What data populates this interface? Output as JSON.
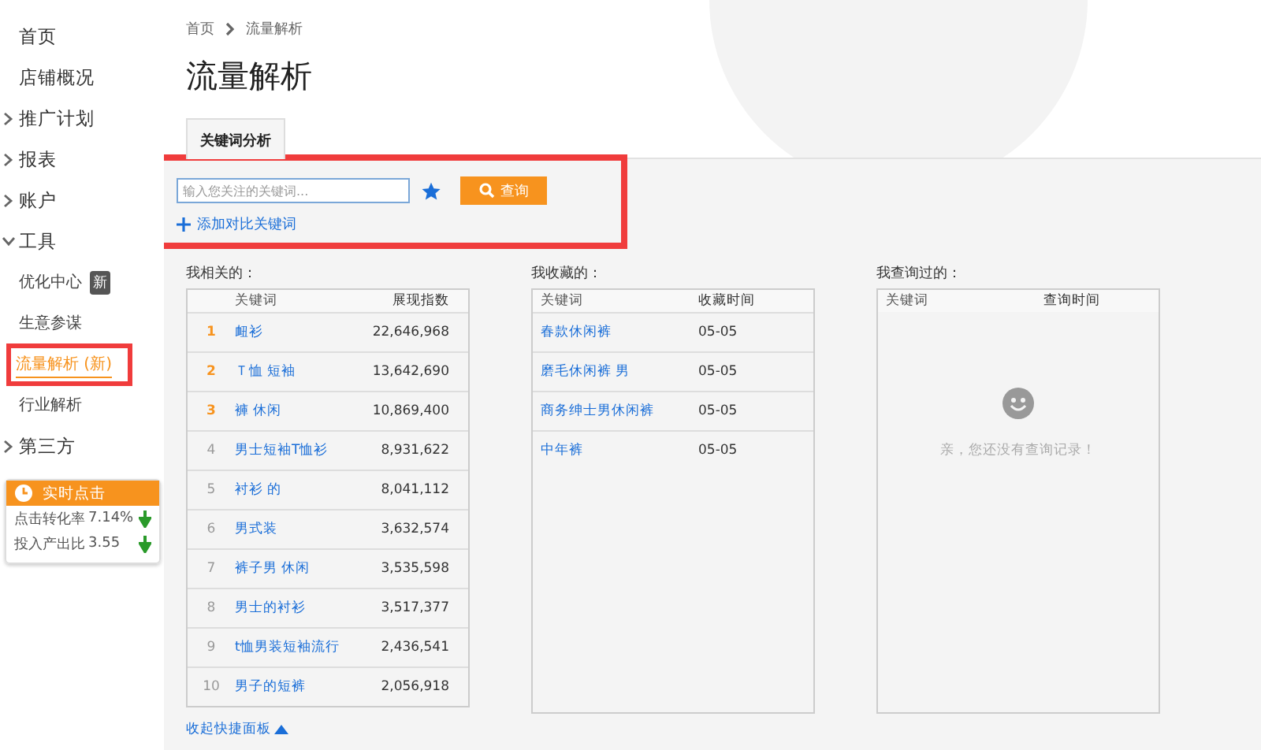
{
  "sidebar": {
    "items": [
      {
        "label": "首页",
        "kind": "link"
      },
      {
        "label": "店铺概况",
        "kind": "link"
      },
      {
        "label": "推广计划",
        "kind": "group",
        "expanded": false
      },
      {
        "label": "报表",
        "kind": "group",
        "expanded": false
      },
      {
        "label": "账户",
        "kind": "group",
        "expanded": false
      },
      {
        "label": "工具",
        "kind": "group",
        "expanded": true,
        "children": [
          {
            "label": "优化中心",
            "badge": "新",
            "selected": false,
            "highlighted": false
          },
          {
            "label": "生意参谋",
            "selected": false,
            "highlighted": false
          },
          {
            "label": "流量解析 (新)",
            "selected": true,
            "highlighted": true
          },
          {
            "label": "行业解析",
            "selected": false,
            "highlighted": false
          }
        ]
      },
      {
        "label": "第三方",
        "kind": "group",
        "expanded": false
      }
    ],
    "widget": {
      "title": "实时点击",
      "rows": [
        {
          "label": "点击转化率",
          "value": "7.14%"
        },
        {
          "label": "投入产出比",
          "value": "3.55"
        }
      ]
    }
  },
  "breadcrumb": [
    "首页",
    "流量解析"
  ],
  "page_title": "流量解析",
  "tabs": [
    {
      "label": "关键词分析",
      "selected": true
    }
  ],
  "search": {
    "placeholder": "输入您关注的关键词...",
    "button": "查询",
    "add_link": "添加对比关键词",
    "highlighted": true
  },
  "related": {
    "title": "我相关的：",
    "columns": [
      "关键词",
      "展现指数"
    ],
    "rows": [
      {
        "rank": "1",
        "keyword": "衄衫",
        "value": "22,646,968",
        "top": true
      },
      {
        "rank": "2",
        "keyword": "Ｔ恤 短袖",
        "value": "13,642,690",
        "top": true
      },
      {
        "rank": "3",
        "keyword": "褲 休闲",
        "value": "10,869,400",
        "top": true
      },
      {
        "rank": "4",
        "keyword": "男士短袖T恤衫",
        "value": "8,931,622",
        "top": false
      },
      {
        "rank": "5",
        "keyword": "衬衫 的",
        "value": "8,041,112",
        "top": false
      },
      {
        "rank": "6",
        "keyword": "男式装",
        "value": "3,632,574",
        "top": false
      },
      {
        "rank": "7",
        "keyword": "裤子男 休闲",
        "value": "3,535,598",
        "top": false
      },
      {
        "rank": "8",
        "keyword": "男士的衬衫",
        "value": "3,517,377",
        "top": false
      },
      {
        "rank": "9",
        "keyword": "t恤男装短袖流行",
        "value": "2,436,541",
        "top": false
      },
      {
        "rank": "10",
        "keyword": "男子的短裤",
        "value": "2,056,918",
        "top": false
      }
    ]
  },
  "favorites": {
    "title": "我收藏的：",
    "columns": [
      "关键词",
      "收藏时间"
    ],
    "rows": [
      {
        "keyword": "春款休闲裤",
        "time": "05-05"
      },
      {
        "keyword": "磨毛休闲裤 男",
        "time": "05-05"
      },
      {
        "keyword": "商务绅士男休闲裤",
        "time": "05-05"
      },
      {
        "keyword": "中年裤",
        "time": "05-05"
      }
    ]
  },
  "history": {
    "title": "我查询过的：",
    "columns": [
      "关键词",
      "查询时间"
    ],
    "empty_text": "亲，您还没有查询记录！"
  },
  "collapse_link": "收起快捷面板"
}
